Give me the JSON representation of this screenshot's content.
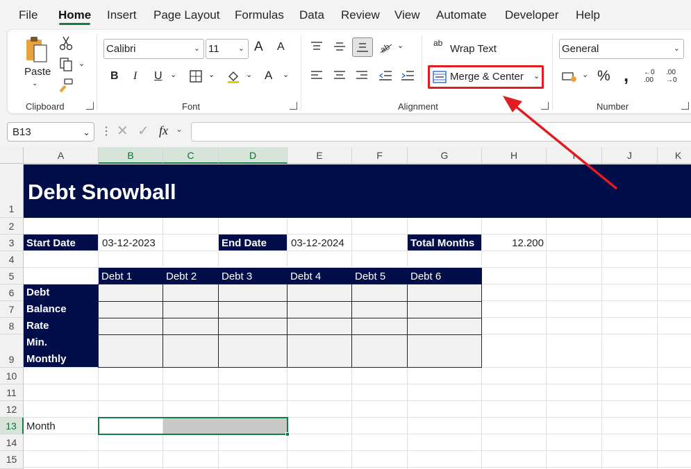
{
  "menu": {
    "items": [
      "File",
      "Home",
      "Insert",
      "Page Layout",
      "Formulas",
      "Data",
      "Review",
      "View",
      "Automate",
      "Developer",
      "Help"
    ],
    "active": "Home"
  },
  "ribbon": {
    "clipboard": {
      "paste_label": "Paste",
      "group_label": "Clipboard"
    },
    "font": {
      "font_name": "Calibri",
      "font_size": "11",
      "bold": "B",
      "italic": "I",
      "underline": "U",
      "grow": "A",
      "shrink": "A",
      "font_color": "A",
      "group_label": "Font"
    },
    "alignment": {
      "wrap_label": "Wrap Text",
      "merge_label": "Merge & Center",
      "group_label": "Alignment",
      "wrap_icon": "ab"
    },
    "number": {
      "format": "General",
      "percent": "%",
      "comma": ",",
      "inc_top": "←0",
      "inc_bottom": ".00",
      "dec_top": ".00",
      "dec_bottom": "→0",
      "group_label": "Number"
    }
  },
  "formula_bar": {
    "name_box": "B13",
    "fx": "fx",
    "formula": ""
  },
  "grid": {
    "columns": [
      "A",
      "B",
      "C",
      "D",
      "E",
      "F",
      "G",
      "H",
      "I",
      "J",
      "K"
    ],
    "selected_columns": [
      "B",
      "C",
      "D"
    ],
    "rows": [
      "1",
      "2",
      "3",
      "4",
      "5",
      "6",
      "7",
      "8",
      "9",
      "10",
      "11",
      "12",
      "13",
      "14",
      "15"
    ],
    "selected_row": "13"
  },
  "sheet": {
    "title": "Debt Snowball",
    "start_date_label": "Start Date",
    "start_date": "03-12-2023",
    "end_date_label": "End Date",
    "end_date": "03-12-2024",
    "total_months_label": "Total Months",
    "total_months": "12.200",
    "debt_headers": [
      "Debt 1",
      "Debt 2",
      "Debt 3",
      "Debt 4",
      "Debt 5",
      "Debt 6"
    ],
    "row_labels": {
      "debt": "Debt",
      "balance": "Balance",
      "rate": "Rate",
      "min1": "Min.",
      "min2": "Monthly"
    },
    "month_label": "Month"
  },
  "colors": {
    "navy": "#020e4a",
    "accent_green": "#137c43",
    "highlight_red": "#e11b22"
  }
}
